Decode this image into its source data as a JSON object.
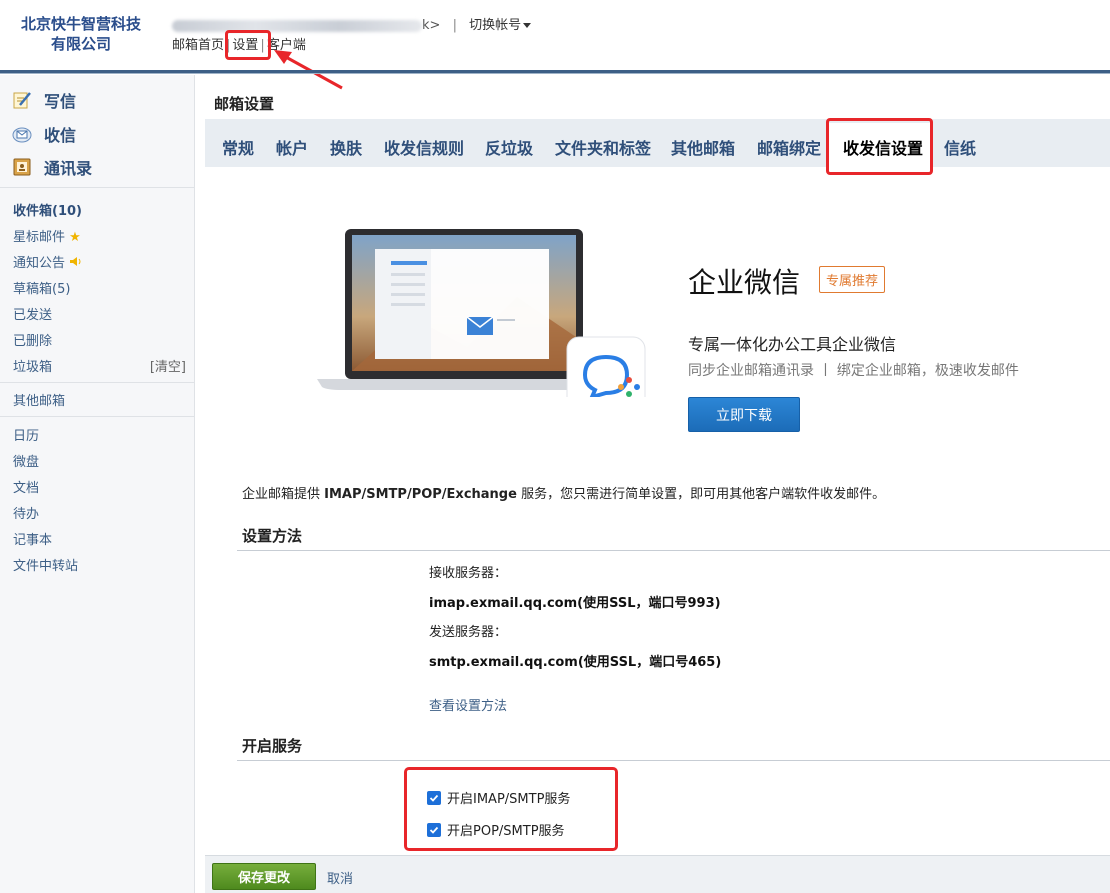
{
  "header": {
    "company_line1": "北京快牛智营科技",
    "company_line2": "有限公司",
    "user_suffix": "k>",
    "switch_account": "切换帐号",
    "links": {
      "home": "邮箱首页",
      "settings": "设置",
      "client": "客户端"
    }
  },
  "sidebar": {
    "compose": "写信",
    "inbox_check": "收信",
    "contacts": "通讯录",
    "folders": {
      "inbox": "收件箱(10)",
      "starred": "星标邮件",
      "notices": "通知公告",
      "drafts": "草稿箱(5)",
      "sent": "已发送",
      "deleted": "已删除",
      "junk": "垃圾箱",
      "junk_clear": "[清空]"
    },
    "other_mailboxes": "其他邮箱",
    "tools": {
      "calendar": "日历",
      "disk": "微盘",
      "docs": "文档",
      "todo": "待办",
      "notes": "记事本",
      "transfer": "文件中转站"
    }
  },
  "main": {
    "page_title": "邮箱设置",
    "tabs": {
      "general": "常规",
      "account": "帐户",
      "skin": "换肤",
      "rules": "收发信规则",
      "antispam": "反垃圾",
      "folders_labels": "文件夹和标签",
      "other_mail": "其他邮箱",
      "binding": "邮箱绑定",
      "client_settings": "收发信设置",
      "stationery": "信纸"
    },
    "promo": {
      "title": "企业微信",
      "badge": "专属推荐",
      "subtitle": "专属一体化办公工具企业微信",
      "desc": "同步企业邮箱通讯录 丨 绑定企业邮箱，极速收发邮件",
      "download": "立即下载"
    },
    "intro": {
      "pre": "企业邮箱提供 ",
      "protocols": "IMAP/SMTP/POP/Exchange",
      "post": " 服务，您只需进行简单设置，即可用其他客户端软件收发邮件。"
    },
    "setup": {
      "title": "设置方法",
      "incoming_label": "接收服务器：",
      "incoming_value": "imap.exmail.qq.com(使用SSL，端口号993)",
      "outgoing_label": "发送服务器：",
      "outgoing_value": "smtp.exmail.qq.com(使用SSL，端口号465)",
      "help_link": "查看设置方法"
    },
    "services": {
      "title": "开启服务",
      "imap": "开启IMAP/SMTP服务",
      "pop": "开启POP/SMTP服务"
    },
    "footer": {
      "save": "保存更改",
      "cancel": "取消"
    }
  },
  "colors": {
    "annotation_red": "#e8262a",
    "brand_blue": "#2f4f7a",
    "download_blue": "#1c6cb8",
    "save_green": "#5a9628"
  }
}
